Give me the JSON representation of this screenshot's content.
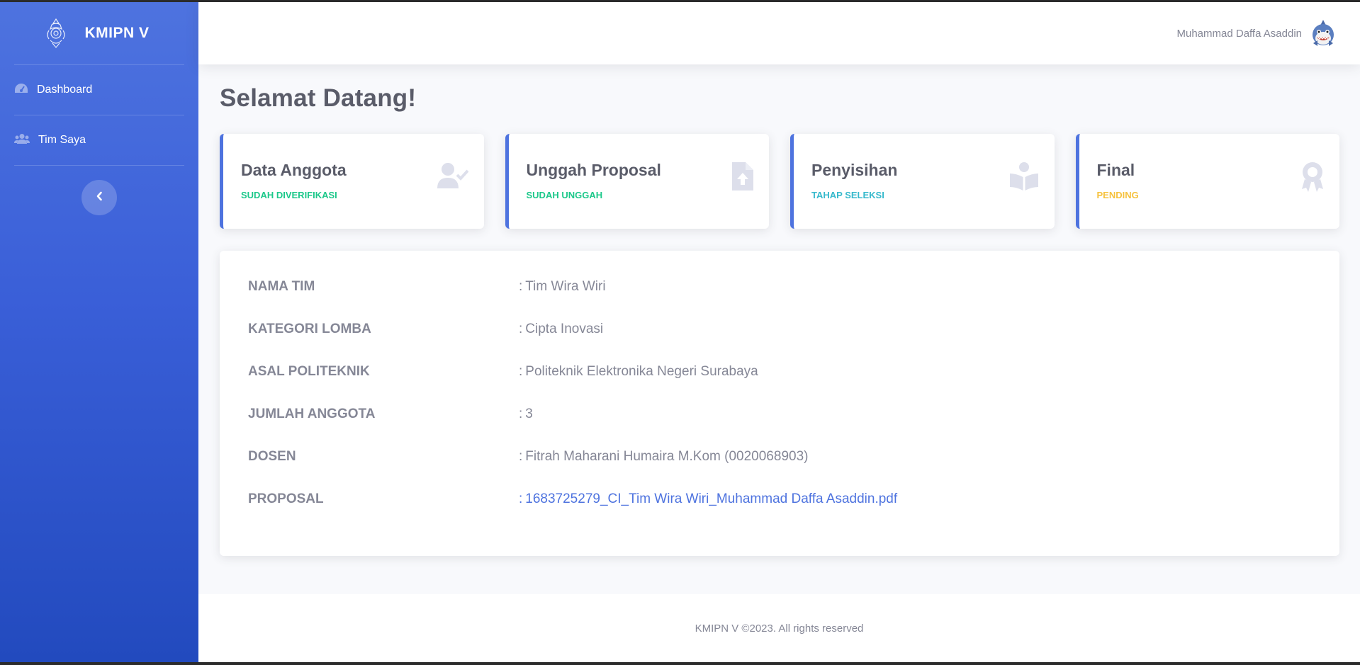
{
  "brand": {
    "name": "KMIPN V"
  },
  "sidebar": {
    "items": [
      {
        "label": "Dashboard",
        "icon": "tachometer-icon"
      },
      {
        "label": "Tim Saya",
        "icon": "users-icon"
      }
    ],
    "toggle_icon": "chevron-left-icon"
  },
  "topbar": {
    "user_name": "Muhammad Daffa Asaddin",
    "avatar_icon": "shark-avatar"
  },
  "page": {
    "title": "Selamat Datang!"
  },
  "cards": [
    {
      "title": "Data Anggota",
      "status": "SUDAH DIVERIFIKASI",
      "status_color": "#1cc88a",
      "icon": "user-check-icon"
    },
    {
      "title": "Unggah Proposal",
      "status": "SUDAH UNGGAH",
      "status_color": "#1cc88a",
      "icon": "file-upload-icon"
    },
    {
      "title": "Penyisihan",
      "status": "TAHAP SELEKSI",
      "status_color": "#36b9cc",
      "icon": "book-reader-icon"
    },
    {
      "title": "Final",
      "status": "PENDING",
      "status_color": "#f6c23e",
      "icon": "award-icon"
    }
  ],
  "team_info": [
    {
      "label": "NAMA TIM",
      "value": "Tim Wira Wiri"
    },
    {
      "label": "KATEGORI LOMBA",
      "value": "Cipta Inovasi"
    },
    {
      "label": "ASAL POLITEKNIK",
      "value": "Politeknik Elektronika Negeri Surabaya"
    },
    {
      "label": "JUMLAH ANGGOTA",
      "value": "3"
    },
    {
      "label": "DOSEN",
      "value": "Fitrah Maharani Humaira M.Kom (0020068903)"
    },
    {
      "label": "PROPOSAL",
      "value": "1683725279_CI_Tim Wira Wiri_Muhammad Daffa Asaddin.pdf"
    }
  ],
  "colors": {
    "primary": "#4e73df",
    "success": "#1cc88a",
    "info": "#36b9cc",
    "warning": "#f6c23e",
    "text_muted": "#858796"
  },
  "footer": {
    "text": "KMIPN V ©2023. All rights reserved"
  }
}
